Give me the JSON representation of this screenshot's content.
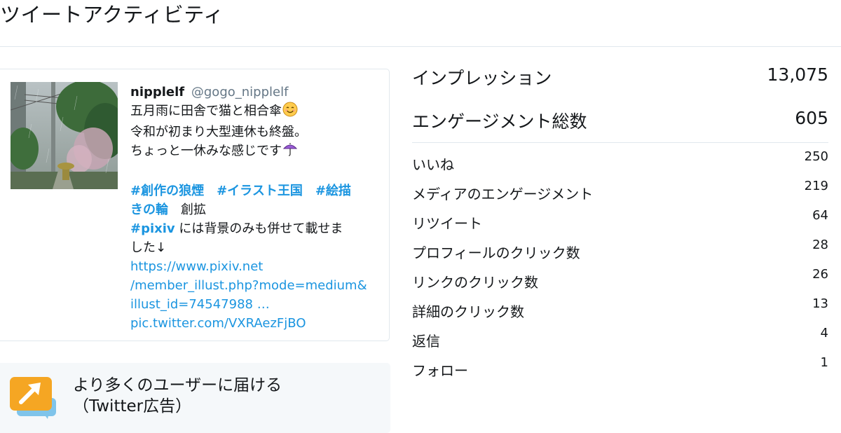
{
  "page": {
    "title": "ツイートアクティビティ"
  },
  "tweet": {
    "author_name": "nipplelf",
    "author_handle": "@gogo_nipplelf",
    "text_lines": [
      "五月雨に田舎で猫と相合傘",
      "令和が初まり大型連休も終盤。",
      "ちょっと一休みな感じです"
    ],
    "emoji_1": "smiling-face-emoji",
    "emoji_2": "umbrella-emoji",
    "hashtags": [
      "#創作の狼煙",
      "#イラスト王国",
      "#絵描",
      "きの輪"
    ],
    "plain_after_tags": "創拡",
    "pixiv_tag": "#pixiv",
    "pixiv_text_1": " には背景のみも併せて載せま",
    "pixiv_text_2": "した↓",
    "link_lines": [
      "https://www.pixiv.net",
      "/member_illust.php?mode=medium&",
      "illust_id=74547988 …"
    ],
    "pic_link": "pic.twitter.com/VXRAezFjBO",
    "thumbnail_icon": "artwork-thumbnail"
  },
  "promote": {
    "icon": "promote-arrow-icon",
    "line1": "より多くのユーザーに届ける",
    "line2": "（Twitter広告）"
  },
  "stats": {
    "impressions": {
      "label": "インプレッション",
      "value": "13,075"
    },
    "engagements": {
      "label": "エンゲージメント総数",
      "value": "605"
    },
    "details": [
      {
        "label": "いいね",
        "value": "250"
      },
      {
        "label": "メディアのエンゲージメント",
        "value": "219"
      },
      {
        "label": "リツイート",
        "value": "64"
      },
      {
        "label": "プロフィールのクリック数",
        "value": "28"
      },
      {
        "label": "リンクのクリック数",
        "value": "26"
      },
      {
        "label": "詳細のクリック数",
        "value": "13"
      },
      {
        "label": "返信",
        "value": "4"
      },
      {
        "label": "フォロー",
        "value": "1"
      }
    ]
  },
  "colors": {
    "link": "#1b95e0",
    "text": "#14171a",
    "muted": "#657786",
    "border": "#e1e8ed",
    "promote_bg": "#f5f8fa",
    "promote_icon": "#f5a623"
  }
}
